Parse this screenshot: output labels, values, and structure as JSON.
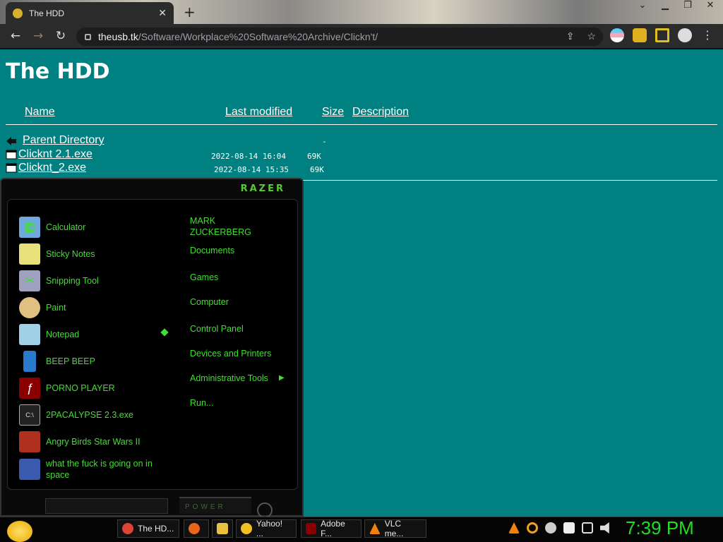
{
  "browser": {
    "tab_title": "The HDD",
    "tab_close": "✕",
    "new_tab": "+",
    "url_host": "theusb.tk",
    "url_path": "/Software/Workplace%20Software%20Archive/Clickn't/"
  },
  "page": {
    "heading": "The HDD",
    "columns": {
      "name": "Name",
      "modified": "Last modified",
      "size": "Size",
      "description": "Description"
    },
    "parent": {
      "label": "Parent Directory",
      "size": "-"
    },
    "files": [
      {
        "name": "Clicknt 2.1.exe",
        "modified": "2022-08-14 16:04",
        "size": "69K"
      },
      {
        "name": "Clicknt_2.exe",
        "modified": "2022-08-14 15:35",
        "size": "69K"
      }
    ]
  },
  "start_menu": {
    "brand": "RAZER",
    "programs": [
      {
        "label": "Calculator",
        "icon": "calculator-icon",
        "color": "#6fa8dc"
      },
      {
        "label": "Sticky Notes",
        "icon": "sticky-notes-icon",
        "color": "#e8e07a"
      },
      {
        "label": "Snipping Tool",
        "icon": "scissors-icon",
        "color": "#a0a0c0"
      },
      {
        "label": "Paint",
        "icon": "paint-palette-icon",
        "color": "#e0c080"
      },
      {
        "label": "Notepad",
        "icon": "notepad-icon",
        "color": "#9fd0e8"
      },
      {
        "label": "BEEP BEEP",
        "icon": "phone-icon",
        "color": "#2a7acc"
      },
      {
        "label": "PORNO PLAYER",
        "icon": "flash-icon",
        "color": "#8a0000"
      },
      {
        "label": "2PACALYPSE 2.3.exe",
        "icon": "console-icon",
        "color": "#222222"
      },
      {
        "label": "Angry Birds Star Wars II",
        "icon": "angry-birds-sw-icon",
        "color": "#b03020"
      },
      {
        "label": "what the fuck is going on in space",
        "icon": "angry-birds-space-icon",
        "color": "#3a5ab0"
      }
    ],
    "places": [
      "MARK ZUCKERBERG",
      "Documents",
      "Games",
      "Computer",
      "Control Panel",
      "Devices and Printers",
      "Administrative Tools",
      "Run..."
    ],
    "power_label": "POWER"
  },
  "taskbar": {
    "items": [
      {
        "label": "The HD...",
        "icon": "chrome-icon",
        "color": "#dd4433"
      },
      {
        "label": "",
        "icon": "firefox-icon",
        "color": "#e8661a"
      },
      {
        "label": "",
        "icon": "folder-icon",
        "color": "#e8c040"
      },
      {
        "label": "Yahoo! ...",
        "icon": "yahoo-messenger-icon",
        "color": "#f0c020"
      },
      {
        "label": "Adobe F...",
        "icon": "flash-icon",
        "color": "#8a0000"
      },
      {
        "label": "VLC me...",
        "icon": "vlc-icon",
        "color": "#f08010"
      }
    ],
    "clock": "7:39 PM"
  }
}
